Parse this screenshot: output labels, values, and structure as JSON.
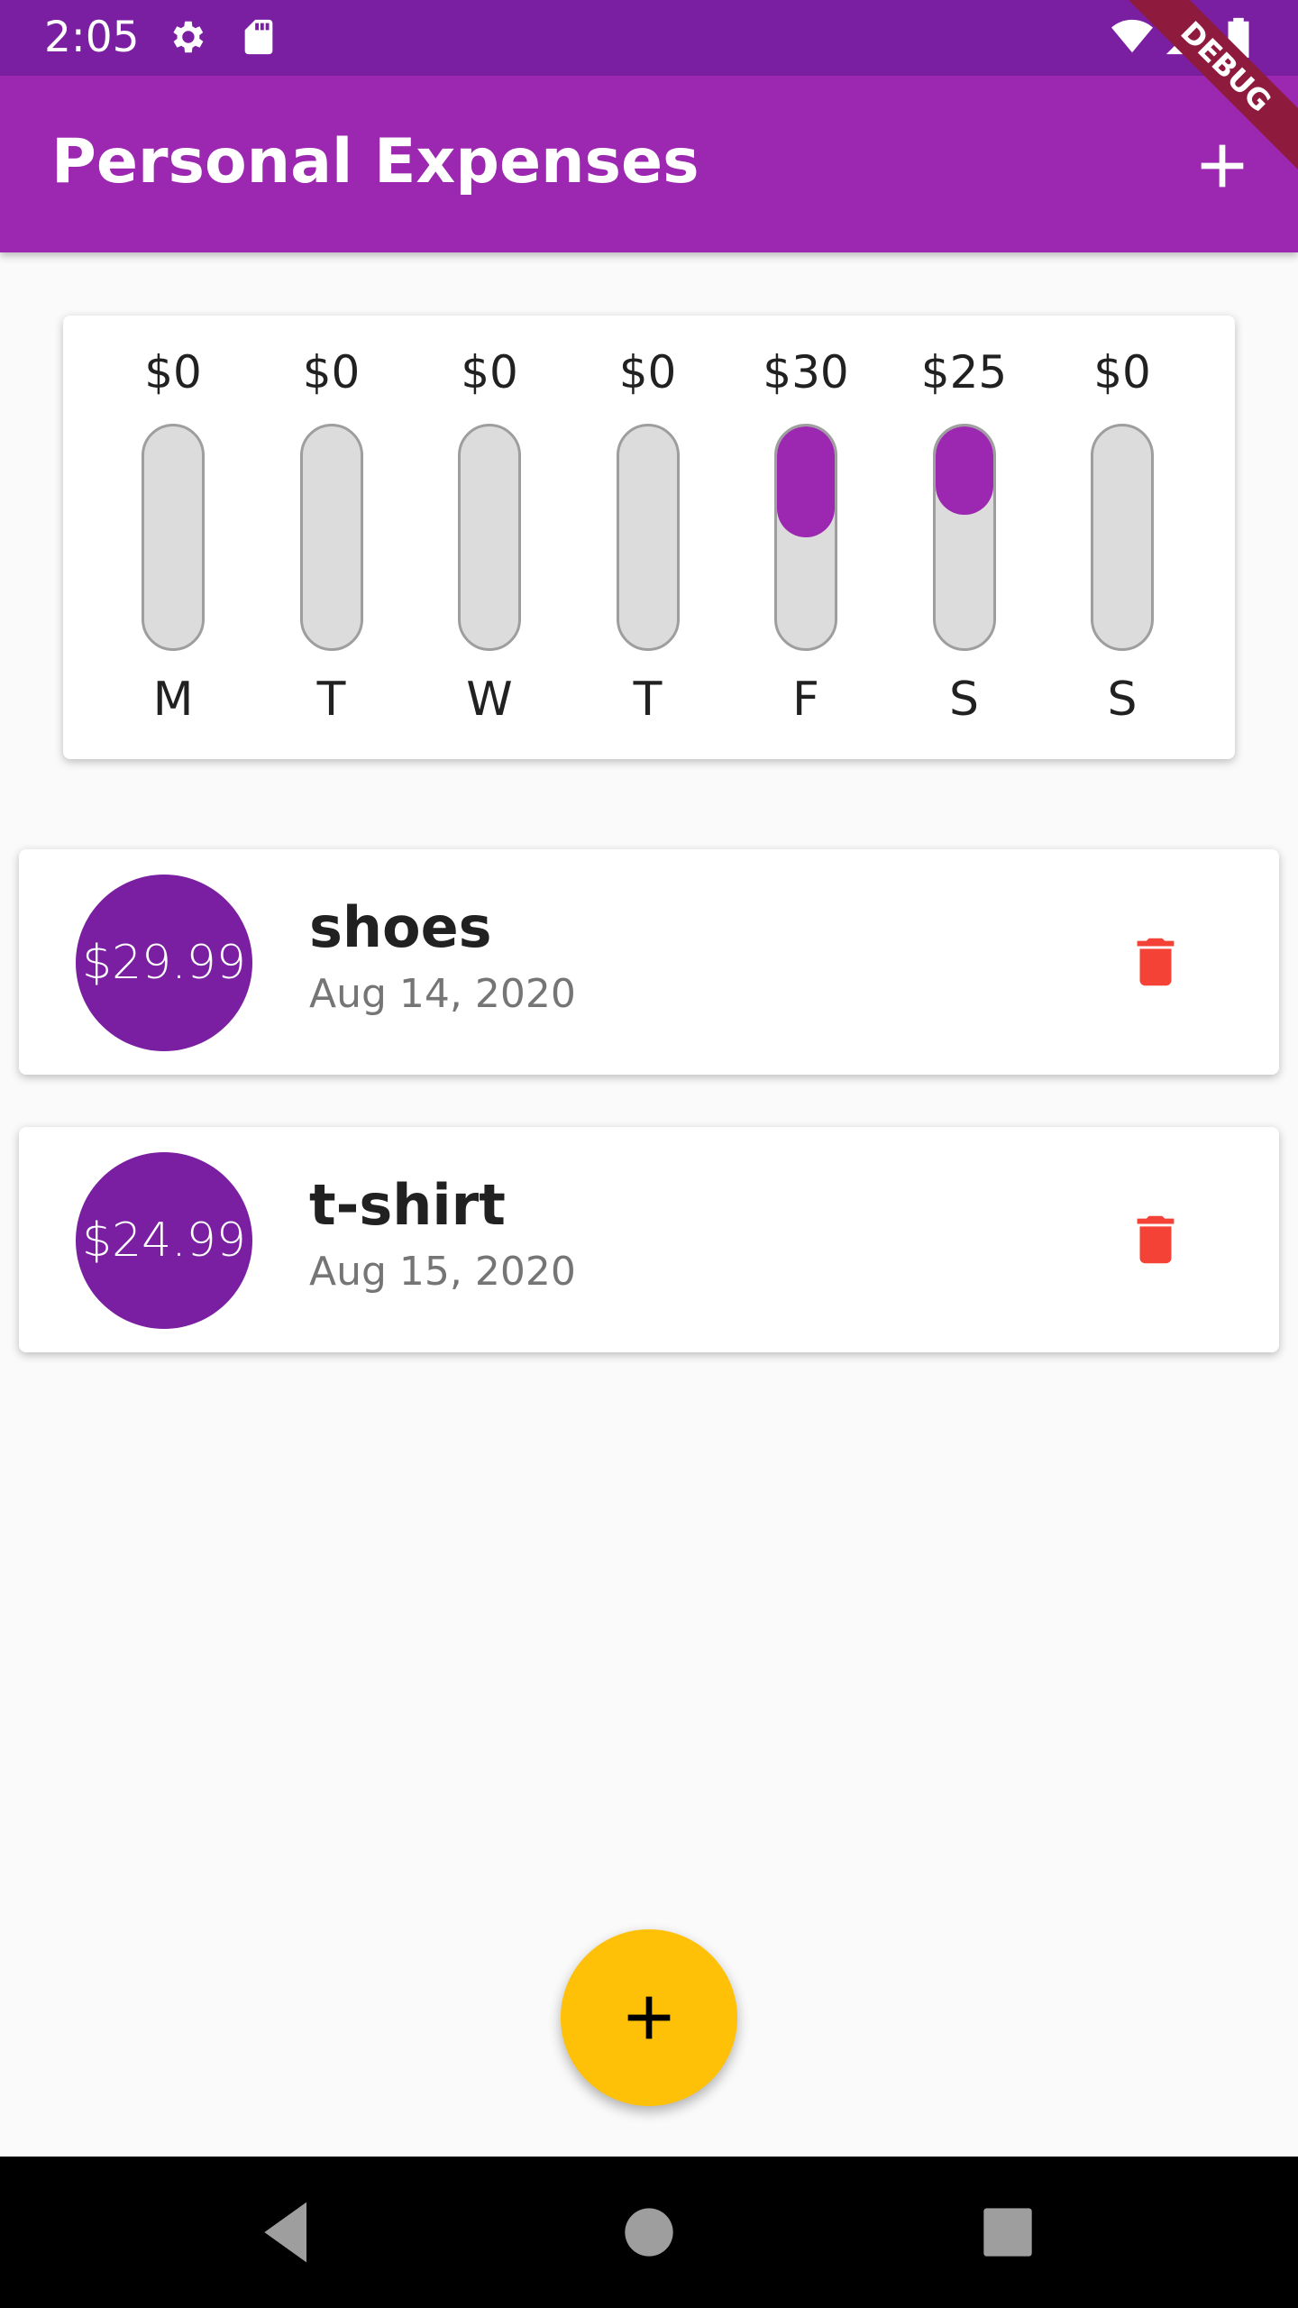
{
  "status_bar": {
    "time": "2:05",
    "icons": [
      "gear-icon",
      "sd-card-icon",
      "wifi-icon",
      "signal-icon",
      "battery-icon"
    ]
  },
  "app_bar": {
    "title": "Personal Expenses",
    "add_icon": "plus-icon",
    "debug_label": "DEBUG",
    "color": "#9c27b0"
  },
  "chart_data": {
    "type": "bar",
    "categories": [
      "M",
      "T",
      "W",
      "T",
      "F",
      "S",
      "S"
    ],
    "amount_labels": [
      "$0",
      "$0",
      "$0",
      "$0",
      "$30",
      "$25",
      "$0"
    ],
    "values": [
      0,
      0,
      0,
      0,
      29.99,
      24.99,
      0
    ],
    "fill_fraction": [
      0,
      0,
      0,
      0,
      0.5,
      0.4,
      0
    ],
    "fill_color": "#9c27b0",
    "track_color": "#dcdcdc",
    "title": "",
    "xlabel": "",
    "ylabel": ""
  },
  "transactions": [
    {
      "amount": "$29.99",
      "title": "shoes",
      "date": "Aug 14, 2020"
    },
    {
      "amount": "$24.99",
      "title": "t-shirt",
      "date": "Aug 15, 2020"
    }
  ],
  "fab": {
    "icon": "plus-icon",
    "color": "#ffc107"
  },
  "nav_bar": {
    "icons": [
      "back-icon",
      "home-icon",
      "recents-icon"
    ]
  },
  "colors": {
    "primary": "#9c27b0",
    "primary_dark": "#7b1fa2",
    "accent": "#ffc107",
    "delete": "#f44336"
  }
}
